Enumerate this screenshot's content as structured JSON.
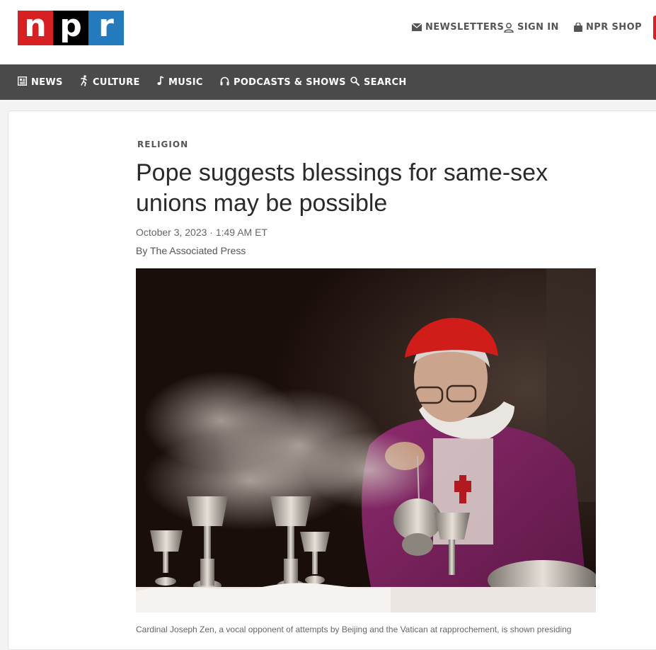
{
  "logo": {
    "letters": [
      "n",
      "p",
      "r"
    ]
  },
  "header": {
    "newsletters": "NEWSLETTERS",
    "sign_in": "SIGN IN",
    "shop": "NPR SHOP"
  },
  "nav": {
    "news": "NEWS",
    "culture": "CULTURE",
    "music": "MUSIC",
    "podcasts": "PODCASTS & SHOWS",
    "search": "SEARCH"
  },
  "article": {
    "slug": "RELIGION",
    "headline": "Pope suggests blessings for same-sex unions may be possible",
    "date": "October 3, 2023 · 1:49 AM ET",
    "byline_prefix": "By ",
    "author": "The Associated Press",
    "caption": "Cardinal Joseph Zen, a vocal opponent of attempts by Beijing and the Vatican at rapprochement, is shown presiding"
  },
  "colors": {
    "npr_red": "#d62021",
    "npr_black": "#000000",
    "npr_blue": "#237bbd",
    "nav_bg": "#4a4a4a"
  },
  "icons": [
    "mail-icon",
    "user-icon",
    "bag-icon",
    "newspaper-icon",
    "culture-icon",
    "music-note-icon",
    "headphones-icon",
    "search-icon"
  ]
}
